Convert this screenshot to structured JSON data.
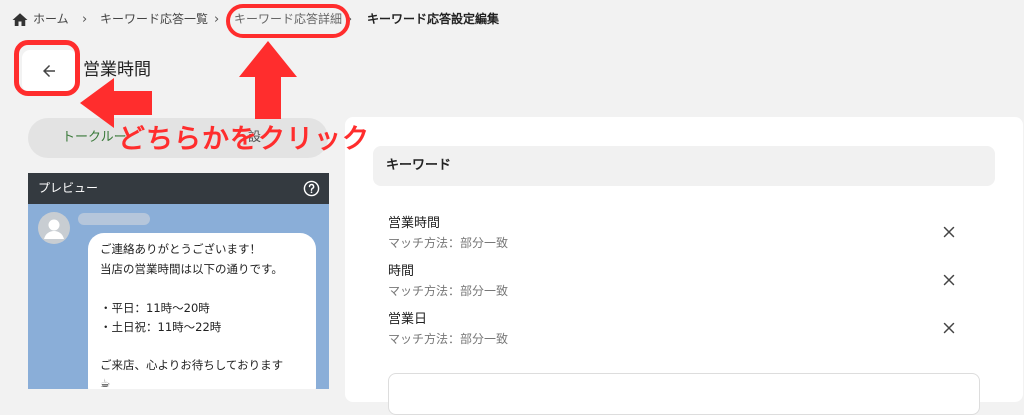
{
  "breadcrumb": {
    "items": [
      {
        "label": "ホーム"
      },
      {
        "label": "キーワード応答一覧"
      },
      {
        "label": "キーワード応答詳細"
      },
      {
        "label": "キーワード応答設定編集"
      }
    ]
  },
  "header": {
    "title": "営業時間"
  },
  "talk_tab": {
    "label": "トークルー",
    "right_label": "設"
  },
  "preview": {
    "title": "プレビュー",
    "message_lines": [
      "ご連絡ありがとうございます！",
      "当店の営業時間は以下の通りです。",
      "",
      "・平日：11時〜20時",
      "・土日祝：11時〜22時",
      "",
      "ご来店、心よりお待ちしております",
      "☕"
    ]
  },
  "keywords": {
    "header": "キーワード",
    "items": [
      {
        "name": "営業時間",
        "match": "マッチ方法：部分一致"
      },
      {
        "name": "時間",
        "match": "マッチ方法：部分一致"
      },
      {
        "name": "営業日",
        "match": "マッチ方法：部分一致"
      }
    ]
  },
  "annotation": {
    "text": "どちらかをクリック",
    "color": "#ff2d2d"
  },
  "icons": {
    "home": "home-icon",
    "back": "arrow-left-icon",
    "help": "help-circle-icon",
    "avatar": "person-icon",
    "remove": "close-icon"
  }
}
